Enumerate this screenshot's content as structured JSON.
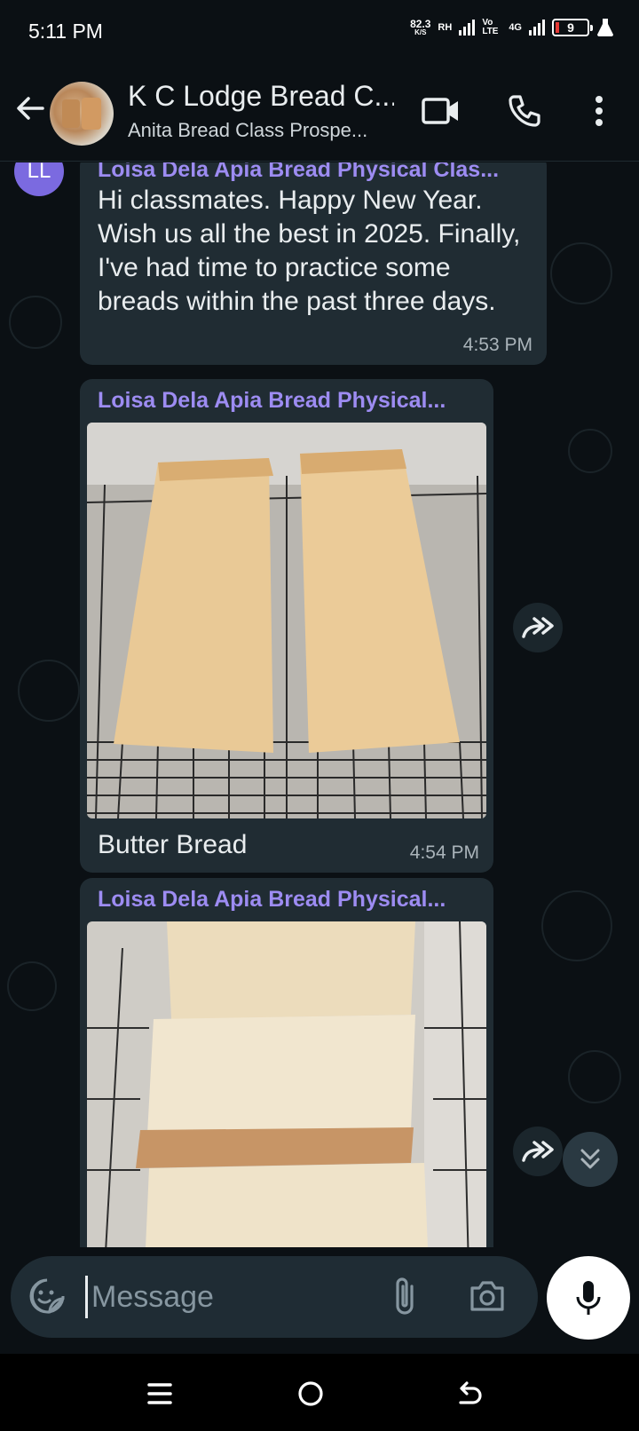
{
  "status_bar": {
    "time": "5:11 PM",
    "net_speed_value": "82.3",
    "net_speed_unit": "K/S",
    "sim1_label": "RH",
    "sim2_label": "Vo LTE",
    "sim2_net": "4G",
    "battery_level": "9"
  },
  "header": {
    "title": "K C Lodge Bread C...",
    "subtitle": "Anita Bread Class Prospe...",
    "icons": [
      "back-arrow-icon",
      "video-call-icon",
      "voice-call-icon",
      "more-options-icon"
    ]
  },
  "messages": [
    {
      "avatar_initials": "LL",
      "sender": "Loisa Dela Apia Bread Physical Clas...",
      "text": "Hi classmates. Happy New Year. Wish us all the best in 2025. Finally, I've had time to practice some breads within the past three days.",
      "time": "4:53 PM"
    },
    {
      "sender": "Loisa Dela Apia Bread Physical...",
      "image": "two-bread-loaves-on-rack",
      "caption": "Butter Bread",
      "time": "4:54 PM"
    },
    {
      "sender": "Loisa Dela Apia Bread Physical...",
      "image": "sliced-bread-on-rack"
    }
  ],
  "composer": {
    "placeholder": "Message",
    "icons": [
      "sticker-icon",
      "attach-icon",
      "camera-icon",
      "mic-icon"
    ]
  },
  "colors": {
    "background": "#0b1014",
    "bubble": "#202c33",
    "sender_name": "#9d8cf2",
    "avatar": "#7b6ae0"
  }
}
